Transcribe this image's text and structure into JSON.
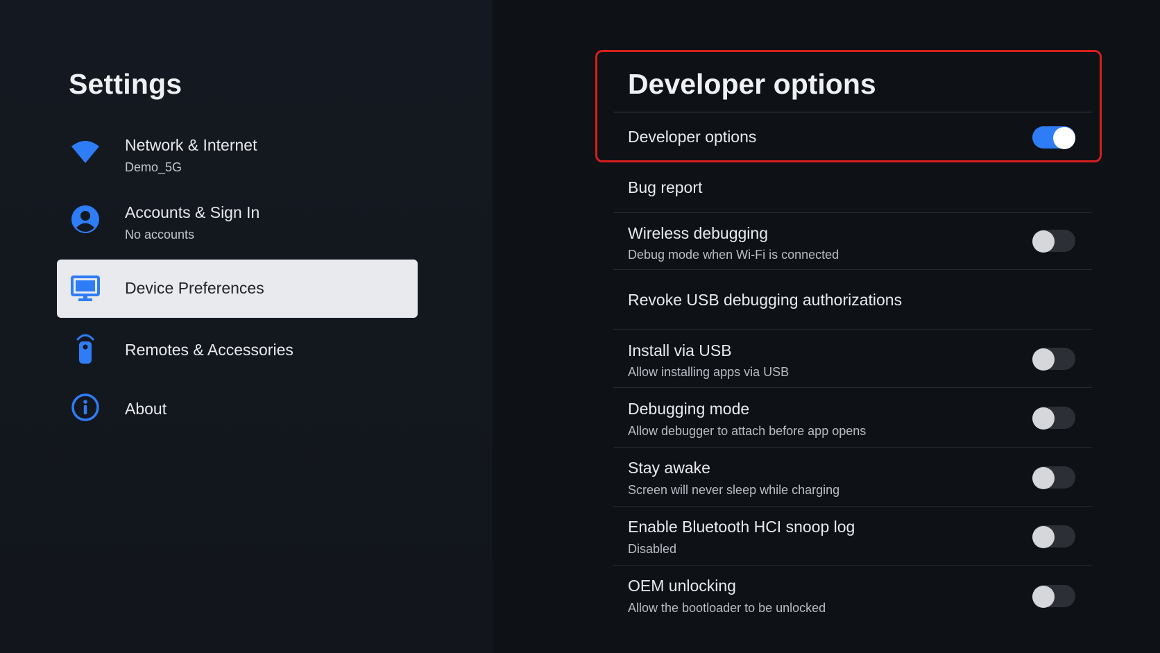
{
  "sidebar": {
    "title": "Settings",
    "items": [
      {
        "label": "Network & Internet",
        "sublabel": "Demo_5G",
        "icon": "wifi-icon"
      },
      {
        "label": "Accounts & Sign In",
        "sublabel": "No accounts",
        "icon": "account-icon"
      },
      {
        "label": "Device Preferences",
        "icon": "tv-icon",
        "selected": true
      },
      {
        "label": "Remotes & Accessories",
        "icon": "remote-icon"
      },
      {
        "label": "About",
        "icon": "info-icon"
      }
    ]
  },
  "developer": {
    "title": "Developer options",
    "master": {
      "label": "Developer options",
      "enabled": true
    },
    "rows": [
      {
        "title": "Bug report"
      },
      {
        "title": "Wireless debugging",
        "subtitle": "Debug mode when Wi-Fi is connected",
        "toggle": false
      },
      {
        "title": "Revoke USB debugging authorizations"
      },
      {
        "title": "Install via USB",
        "subtitle": "Allow installing apps via USB",
        "toggle": false
      },
      {
        "title": "Debugging mode",
        "subtitle": "Allow debugger to attach before app opens",
        "toggle": false
      },
      {
        "title": "Stay awake",
        "subtitle": "Screen will never sleep while charging",
        "toggle": false
      },
      {
        "title": "Enable Bluetooth HCI snoop log",
        "subtitle": "Disabled",
        "toggle": false
      },
      {
        "title": "OEM unlocking",
        "subtitle": "Allow the bootloader to be unlocked",
        "toggle": false
      }
    ]
  },
  "colors": {
    "accent": "#2f7df6",
    "highlight_border": "#d81e1e",
    "icon_blue": "#2f7df6"
  }
}
